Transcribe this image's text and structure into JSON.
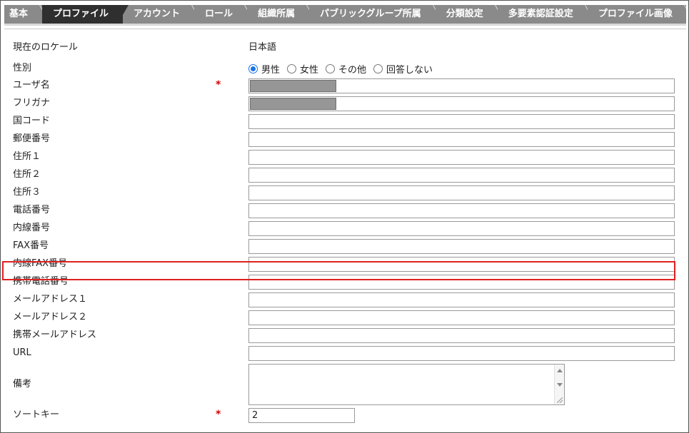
{
  "tabs": [
    {
      "label": "基本",
      "active": false
    },
    {
      "label": "プロファイル",
      "active": true
    },
    {
      "label": "アカウント",
      "active": false
    },
    {
      "label": "ロール",
      "active": false
    },
    {
      "label": "組織所属",
      "active": false
    },
    {
      "label": "パブリックグループ所属",
      "active": false
    },
    {
      "label": "分類設定",
      "active": false
    },
    {
      "label": "多要素認証設定",
      "active": false
    },
    {
      "label": "プロファイル画像",
      "active": false
    }
  ],
  "form": {
    "locale_label": "現在のロケール",
    "locale_value": "日本語",
    "gender_label": "性別",
    "gender_options": [
      {
        "label": "男性",
        "selected": true
      },
      {
        "label": "女性",
        "selected": false
      },
      {
        "label": "その他",
        "selected": false
      },
      {
        "label": "回答しない",
        "selected": false
      }
    ],
    "required_mark": "*",
    "fields": [
      {
        "label": "ユーザ名",
        "value": "",
        "required": true,
        "masked": true
      },
      {
        "label": "フリガナ",
        "value": "",
        "required": false,
        "masked": true
      },
      {
        "label": "国コード",
        "value": ""
      },
      {
        "label": "郵便番号",
        "value": ""
      },
      {
        "label": "住所１",
        "value": ""
      },
      {
        "label": "住所２",
        "value": ""
      },
      {
        "label": "住所３",
        "value": ""
      },
      {
        "label": "電話番号",
        "value": ""
      },
      {
        "label": "内線番号",
        "value": ""
      },
      {
        "label": "FAX番号",
        "value": ""
      },
      {
        "label": "内線FAX番号",
        "value": ""
      },
      {
        "label": "携帯電話番号",
        "value": ""
      },
      {
        "label": "メールアドレス１",
        "value": "",
        "highlighted": true
      },
      {
        "label": "メールアドレス２",
        "value": ""
      },
      {
        "label": "携帯メールアドレス",
        "value": ""
      },
      {
        "label": "URL",
        "value": ""
      }
    ],
    "remarks_label": "備考",
    "remarks_value": "",
    "sortkey_label": "ソートキー",
    "sortkey_value": "2"
  },
  "colors": {
    "tab_bg": "#8a8a8a",
    "tab_active_bg": "#2f2f2f",
    "required": "#d40000",
    "highlight": "#e02020",
    "radio_selected": "#1a73e8"
  }
}
